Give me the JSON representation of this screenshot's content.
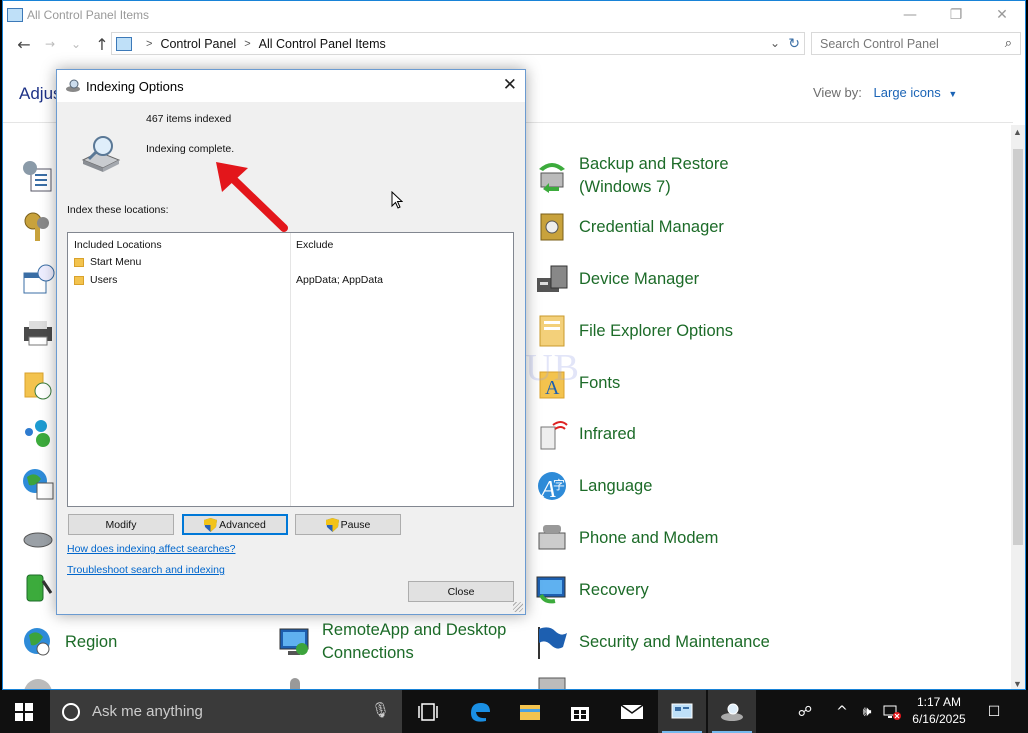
{
  "window": {
    "title": "All Control Panel Items",
    "minimize": "—",
    "maximize": "❐",
    "close": "✕"
  },
  "navigation": {
    "back": "←",
    "forward": "→",
    "recent": "⌄",
    "up": "↑",
    "breadcrumb": [
      "Control Panel",
      "All Control Panel Items"
    ],
    "separator": ">",
    "dropdown": "⌄",
    "refresh": "↻"
  },
  "search": {
    "placeholder": "Search Control Panel",
    "icon": "⌕"
  },
  "header": {
    "heading_partial": "Adjus",
    "view_by_label": "View by:",
    "view_by_value": "Large icons",
    "view_by_caret": "▼"
  },
  "items": {
    "backup_restore": "Backup and Restore (Windows 7)",
    "credential_manager": "Credential Manager",
    "device_manager": "Device Manager",
    "file_explorer_options": "File Explorer Options",
    "fonts": "Fonts",
    "infrared": "Infrared",
    "language": "Language",
    "phone_modem": "Phone and Modem",
    "recovery": "Recovery",
    "region": "Region",
    "remoteapp": "RemoteApp and Desktop Connections",
    "security_maintenance": "Security and Maintenance"
  },
  "watermark": "IT Pros HUB",
  "dialog": {
    "title": "Indexing Options",
    "close_glyph": "✕",
    "items_indexed": "467 items indexed",
    "status": "Indexing complete.",
    "index_label": "Index these locations:",
    "columns": {
      "included": "Included Locations",
      "exclude": "Exclude"
    },
    "locations": [
      {
        "name": "Start Menu",
        "exclude": ""
      },
      {
        "name": "Users",
        "exclude": "AppData; AppData"
      }
    ],
    "buttons": {
      "modify": "Modify",
      "advanced": "Advanced",
      "pause": "Pause",
      "close": "Close"
    },
    "links": {
      "how_indexing": "How does indexing affect searches?",
      "troubleshoot": "Troubleshoot search and indexing"
    }
  },
  "taskbar": {
    "search_placeholder": "Ask me anything",
    "mic": "🎙",
    "time": "1:17 AM",
    "date": "6/16/2025",
    "tray": {
      "people": "☍",
      "chevron": "^",
      "volume": "🕪",
      "notifications": "☐"
    }
  },
  "colors": {
    "link_green": "#1c6b28",
    "link_blue": "#0066cc",
    "annotation_arrow": "#e3161b",
    "taskbar_bg": "#101010",
    "accent": "#0078d7"
  }
}
